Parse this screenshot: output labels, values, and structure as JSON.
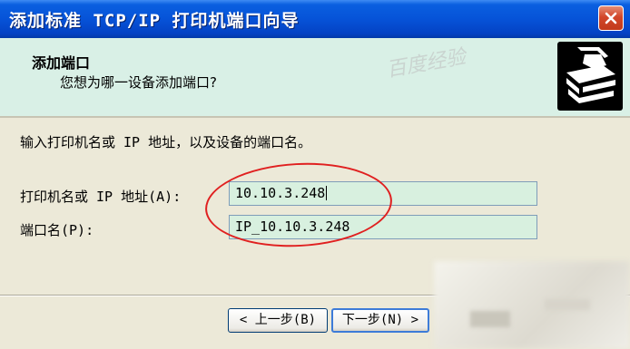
{
  "window": {
    "title": "添加标准 TCP/IP 打印机端口向导",
    "close_glyph": "✕"
  },
  "header": {
    "title": "添加端口",
    "subtitle": "您想为哪一设备添加端口?",
    "watermark": "百度经验"
  },
  "body": {
    "instruction": "输入打印机名或 IP 地址，以及设备的端口名。",
    "fields": [
      {
        "label": "打印机名或 IP 地址(A):",
        "value": "10.10.3.248"
      },
      {
        "label": "端口名(P):",
        "value": "IP_10.10.3.248"
      }
    ]
  },
  "buttons": {
    "back": "< 上一步(B)",
    "next": "下一步(N) >"
  },
  "icons": {
    "close": "close-icon",
    "printer": "printer-icon"
  },
  "colors": {
    "titlebar": "#0653d8",
    "header_bg": "#d9f0e6",
    "input_bg": "#d8f0df",
    "annotation": "#e02020",
    "dialog_bg": "#ece9d8"
  }
}
